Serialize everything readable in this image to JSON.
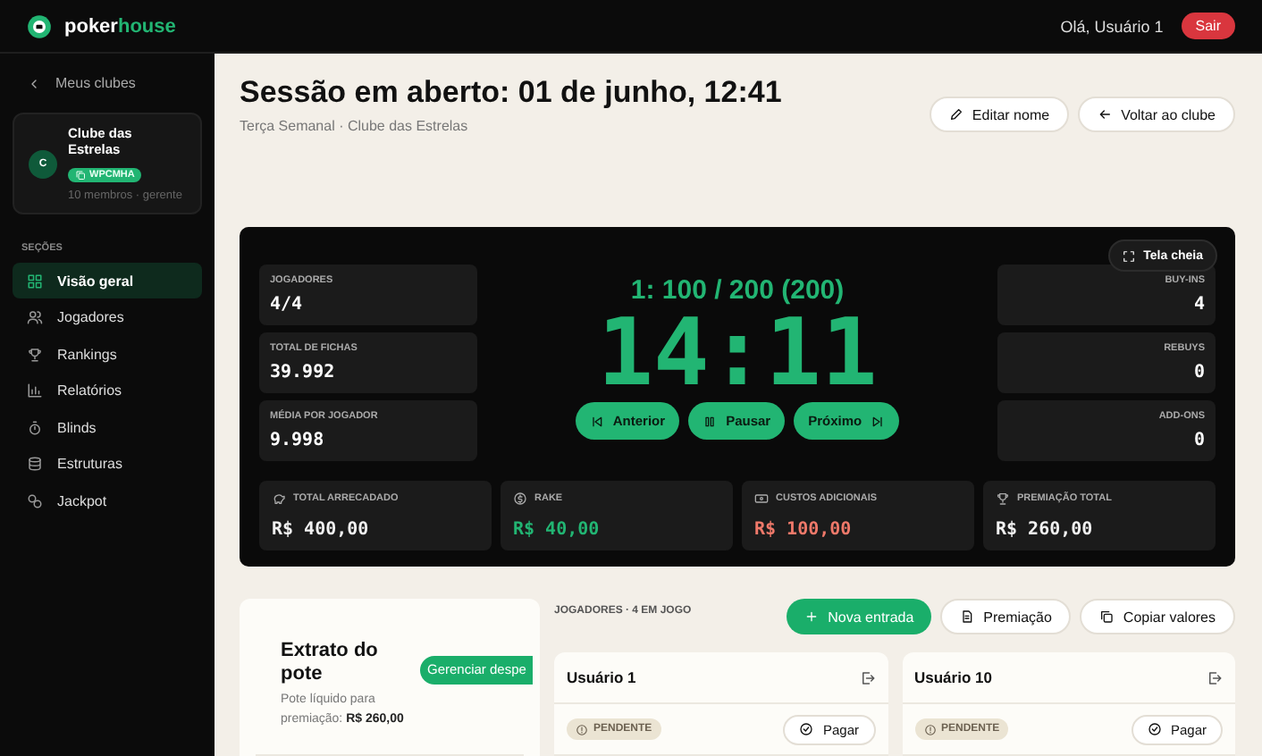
{
  "topbar": {
    "brand": [
      "poker",
      "house"
    ],
    "greeting": "Olá, Usuário 1",
    "logout": "Sair"
  },
  "sidebar": {
    "back": "Meus clubes",
    "club": {
      "avatar": "C",
      "name": "Clube das Estrelas",
      "code": "WPCMHA",
      "meta": "10 membros · gerente"
    },
    "section_label": "SEÇÕES",
    "items": [
      {
        "label": "Visão geral",
        "selected": true
      },
      {
        "label": "Jogadores",
        "selected": false
      },
      {
        "label": "Rankings",
        "selected": false
      },
      {
        "label": "Relatórios",
        "selected": false
      },
      {
        "label": "Blinds",
        "selected": false
      },
      {
        "label": "Estruturas",
        "selected": false
      },
      {
        "label": "Jackpot",
        "selected": false
      }
    ]
  },
  "header": {
    "title": "Sessão em aberto: 01 de junho, 12:41",
    "subtitle": "Terça Semanal · Clube das Estrelas",
    "buttons": [
      "Editar nome",
      "Voltar ao clube"
    ]
  },
  "clock": {
    "fullscreen": "Tela cheia",
    "level": "1: 100 / 200 (200)",
    "time": "14:11",
    "controls": [
      "Anterior",
      "Pausar",
      "Próximo"
    ],
    "left_stats": [
      {
        "label": "JOGADORES",
        "value": "4/4"
      },
      {
        "label": "TOTAL DE FICHAS",
        "value": "39.992"
      },
      {
        "label": "MÉDIA POR JOGADOR",
        "value": "9.998"
      }
    ],
    "right_stats": [
      {
        "label": "BUY-INS",
        "value": "4"
      },
      {
        "label": "REBUYS",
        "value": "0"
      },
      {
        "label": "ADD-ONS",
        "value": "0"
      }
    ],
    "totals": [
      {
        "label": "TOTAL ARRECADADO",
        "value": "R$ 400,00",
        "color": "#f2f2f2"
      },
      {
        "label": "RAKE",
        "value": "R$ 40,00",
        "color": "#22b573"
      },
      {
        "label": "CUSTOS ADICIONAIS",
        "value": "R$ 100,00",
        "color": "#f0796a"
      },
      {
        "label": "PREMIAÇÃO TOTAL",
        "value": "R$ 260,00",
        "color": "#f2f2f2"
      }
    ]
  },
  "pot": {
    "title": "Extrato do pote",
    "description": "Pote líquido para premiação: **R$ 260,00**",
    "button": "Gerenciar despe"
  },
  "players": {
    "heading": "JOGADORES · 4 EM JOGO",
    "actions": [
      "Nova entrada",
      "Premiação",
      "Copiar valores"
    ],
    "cards": [
      {
        "name": "Usuário 1",
        "status": "PENDENTE",
        "action": "Pagar"
      },
      {
        "name": "Usuário 10",
        "status": "PENDENTE",
        "action": "Pagar"
      }
    ]
  }
}
